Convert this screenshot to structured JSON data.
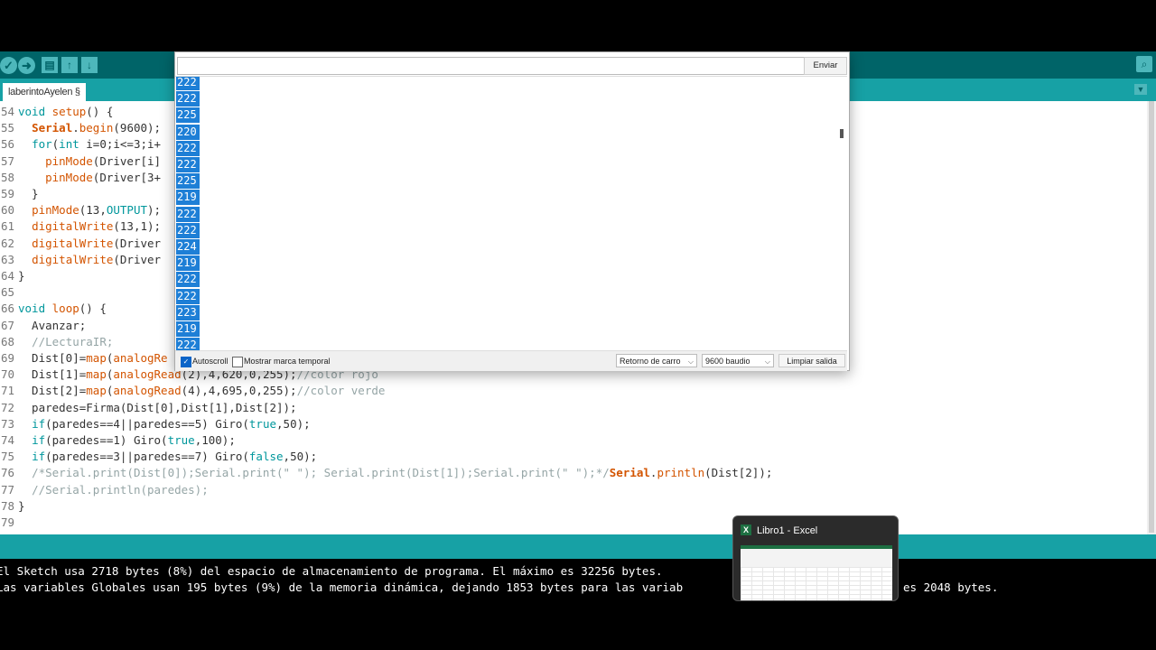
{
  "toolbar": {
    "verify_icon": "check-icon",
    "upload_icon": "arrow-right-icon",
    "new_icon": "new-file-icon",
    "open_icon": "arrow-up-icon",
    "save_icon": "arrow-down-icon",
    "serial_monitor_icon": "magnifier-icon"
  },
  "tab": {
    "label": "laberintoAyelen §"
  },
  "code": [
    {
      "n": "54",
      "t": "void setup() {"
    },
    {
      "n": "55",
      "t": "  Serial.begin(9600);"
    },
    {
      "n": "56",
      "t": "  for(int i=0;i<=3;i+"
    },
    {
      "n": "57",
      "t": "    pinMode(Driver[i]"
    },
    {
      "n": "58",
      "t": "    pinMode(Driver[3+"
    },
    {
      "n": "59",
      "t": "  }"
    },
    {
      "n": "60",
      "t": "  pinMode(13,OUTPUT);"
    },
    {
      "n": "61",
      "t": "  digitalWrite(13,1);"
    },
    {
      "n": "62",
      "t": "  digitalWrite(Driver"
    },
    {
      "n": "63",
      "t": "  digitalWrite(Driver"
    },
    {
      "n": "64",
      "t": "}"
    },
    {
      "n": "65",
      "t": ""
    },
    {
      "n": "66",
      "t": "void loop() {"
    },
    {
      "n": "67",
      "t": "  Avanzar;"
    },
    {
      "n": "68",
      "t": "  //LecturaIR;"
    },
    {
      "n": "69",
      "t": "  Dist[0]=map(analogRe"
    },
    {
      "n": "70",
      "t": "  Dist[1]=map(analogRead(2),4,620,0,255);//color rojo"
    },
    {
      "n": "71",
      "t": "  Dist[2]=map(analogRead(4),4,695,0,255);//color verde"
    },
    {
      "n": "72",
      "t": "  paredes=Firma(Dist[0],Dist[1],Dist[2]);"
    },
    {
      "n": "73",
      "t": "  if(paredes==4||paredes==5) Giro(true,50);"
    },
    {
      "n": "74",
      "t": "  if(paredes==1) Giro(true,100);"
    },
    {
      "n": "75",
      "t": "  if(paredes==3||paredes==7) Giro(false,50);"
    },
    {
      "n": "76",
      "t": "  /*Serial.print(Dist[0]);Serial.print(\" \"); Serial.print(Dist[1]);Serial.print(\" \");*/Serial.println(Dist[2]);"
    },
    {
      "n": "77",
      "t": "  //Serial.println(paredes);"
    },
    {
      "n": "78",
      "t": "}"
    },
    {
      "n": "79",
      "t": ""
    }
  ],
  "console": {
    "line1": "El Sketch usa 2718 bytes (8%) del espacio de almacenamiento de programa. El máximo es 32256 bytes.",
    "line2a": "Las variables Globales usan 195 bytes (9%) de la memoria dinámica, dejando 1853 bytes para las variab",
    "line2b": "es 2048 bytes."
  },
  "monitor": {
    "input_value": "",
    "send_label": "Enviar",
    "values": [
      "222",
      "222",
      "225",
      "220",
      "222",
      "222",
      "225",
      "219",
      "222",
      "222",
      "224",
      "219",
      "222",
      "222",
      "223",
      "219",
      "222"
    ],
    "autoscroll_label": "Autoscroll",
    "autoscroll_checked": true,
    "timestamp_label": "Mostrar marca temporal",
    "timestamp_checked": false,
    "line_ending": "Retorno de carro",
    "baud": "9600 baudio",
    "clear_label": "Limpiar salida"
  },
  "taskbar_preview": {
    "title": "Libro1 - Excel",
    "icon": "excel-icon"
  },
  "colors": {
    "toolbar": "#006468",
    "tabbar": "#17a1a5",
    "highlight": "#1e7fd6",
    "keyword": "#d35400",
    "constant": "#00979c",
    "comment": "#95a5a6"
  }
}
